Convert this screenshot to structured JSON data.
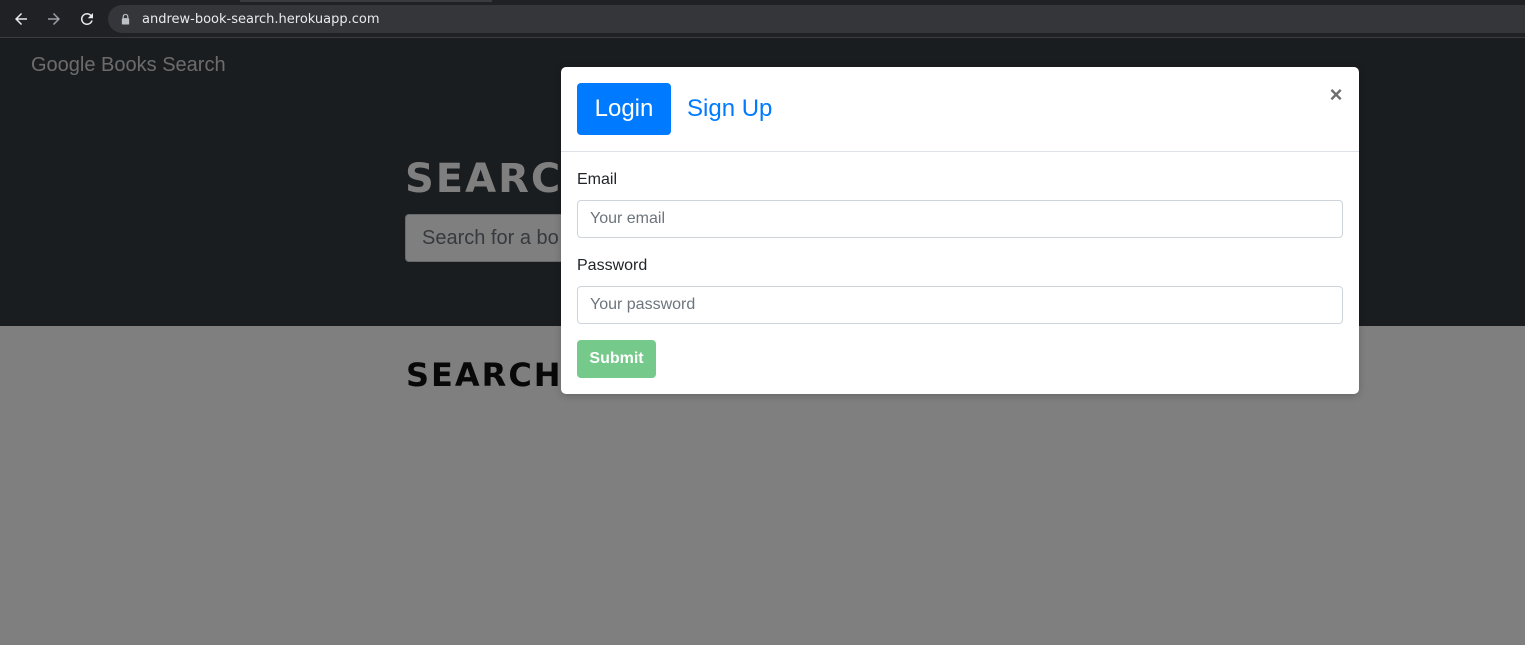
{
  "browser": {
    "url": "andrew-book-search.herokuapp.com",
    "icons": [
      "back-arrow-icon",
      "forward-arrow-icon",
      "reload-icon",
      "lock-icon"
    ]
  },
  "navbar": {
    "brand": "Google Books Search"
  },
  "hero": {
    "title": "SEARC",
    "search_placeholder": "Search for a bo"
  },
  "results": {
    "title": "SEARCH"
  },
  "modal": {
    "tabs": [
      {
        "label": "Login",
        "active": true
      },
      {
        "label": "Sign Up",
        "active": false
      }
    ],
    "close_label": "×",
    "email_label": "Email",
    "email_placeholder": "Your email",
    "password_label": "Password",
    "password_placeholder": "Your password",
    "submit_label": "Submit"
  },
  "colors": {
    "primary": "#007bff",
    "success_disabled": "#75c98a",
    "navbar_dark": "#343a40",
    "chrome_dark": "#202124"
  }
}
